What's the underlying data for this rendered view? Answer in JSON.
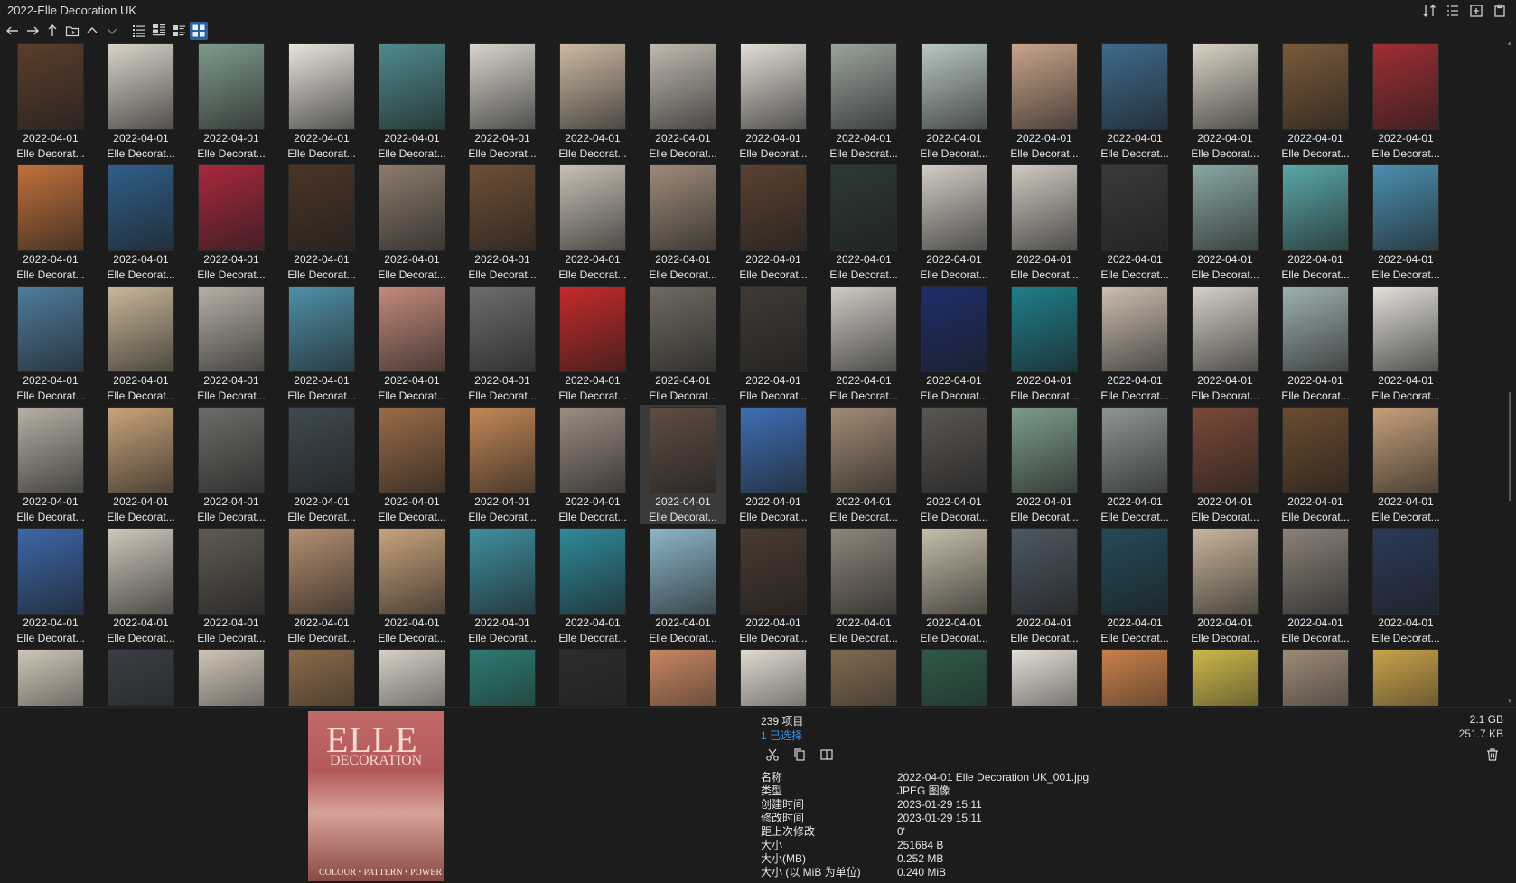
{
  "window": {
    "title": "2022-Elle Decoration UK"
  },
  "toolbar_icons": {
    "top_right": [
      "sort-icon",
      "details-view-icon",
      "new-tab-icon",
      "clipboard-icon"
    ],
    "nav": [
      "back-arrow-icon",
      "forward-arrow-icon",
      "up-arrow-icon",
      "folder-icon",
      "chevron-up-icon",
      "chevron-down-icon",
      "list-view-icon",
      "details-view-icon",
      "tiles-view-icon",
      "thumbnails-view-icon"
    ]
  },
  "grid": {
    "items": [
      {
        "l1": "2022-04-01",
        "l2": "Elle Decorat...",
        "c": "#5a3e2c"
      },
      {
        "l1": "2022-04-01",
        "l2": "Elle Decorat...",
        "c": "#d9d3c8"
      },
      {
        "l1": "2022-04-01",
        "l2": "Elle Decorat...",
        "c": "#7e9a8b"
      },
      {
        "l1": "2022-04-01",
        "l2": "Elle Decorat...",
        "c": "#e8e4dc"
      },
      {
        "l1": "2022-04-01",
        "l2": "Elle Decorat...",
        "c": "#4f8a8c"
      },
      {
        "l1": "2022-04-01",
        "l2": "Elle Decorat...",
        "c": "#d8d4cc"
      },
      {
        "l1": "2022-04-01",
        "l2": "Elle Decorat...",
        "c": "#cbb9a4"
      },
      {
        "l1": "2022-04-01",
        "l2": "Elle Decorat...",
        "c": "#bfb8ae"
      },
      {
        "l1": "2022-04-01",
        "l2": "Elle Decorat...",
        "c": "#e2ddd5"
      },
      {
        "l1": "2022-04-01",
        "l2": "Elle Decorat...",
        "c": "#9aa39c"
      },
      {
        "l1": "2022-04-01",
        "l2": "Elle Decorat...",
        "c": "#b8c7c2"
      },
      {
        "l1": "2022-04-01",
        "l2": "Elle Decorat...",
        "c": "#c9a48a"
      },
      {
        "l1": "2022-04-01",
        "l2": "Elle Decorat...",
        "c": "#3e6a8c"
      },
      {
        "l1": "2022-04-01",
        "l2": "Elle Decorat...",
        "c": "#d9d2c4"
      },
      {
        "l1": "2022-04-01",
        "l2": "Elle Decorat...",
        "c": "#7a5a3a"
      },
      {
        "l1": "2022-04-01",
        "l2": "Elle Decorat...",
        "c": "#9e2e34"
      },
      {
        "l1": "2022-04-01",
        "l2": "Elle Decorat...",
        "c": "#c0713c"
      },
      {
        "l1": "2022-04-01",
        "l2": "Elle Decorat...",
        "c": "#2f5f8a"
      },
      {
        "l1": "2022-04-01",
        "l2": "Elle Decorat...",
        "c": "#a8283c"
      },
      {
        "l1": "2022-04-01",
        "l2": "Elle Decorat...",
        "c": "#4a3526"
      },
      {
        "l1": "2022-04-01",
        "l2": "Elle Decorat...",
        "c": "#8b7b6c"
      },
      {
        "l1": "2022-04-01",
        "l2": "Elle Decorat...",
        "c": "#6e4f37"
      },
      {
        "l1": "2022-04-01",
        "l2": "Elle Decorat...",
        "c": "#c8c0b5"
      },
      {
        "l1": "2022-04-01",
        "l2": "Elle Decorat...",
        "c": "#9c8a78"
      },
      {
        "l1": "2022-04-01",
        "l2": "Elle Decorat...",
        "c": "#5a4130"
      },
      {
        "l1": "2022-04-01",
        "l2": "Elle Decorat...",
        "c": "#2d3a34"
      },
      {
        "l1": "2022-04-01",
        "l2": "Elle Decorat...",
        "c": "#d2cdc5"
      },
      {
        "l1": "2022-04-01",
        "l2": "Elle Decorat...",
        "c": "#cfcac1"
      },
      {
        "l1": "2022-04-01",
        "l2": "Elle Decorat...",
        "c": "#3c3a38"
      },
      {
        "l1": "2022-04-01",
        "l2": "Elle Decorat...",
        "c": "#89a7a3"
      },
      {
        "l1": "2022-04-01",
        "l2": "Elle Decorat...",
        "c": "#5aa7a7"
      },
      {
        "l1": "2022-04-01",
        "l2": "Elle Decorat...",
        "c": "#4a8fb0"
      },
      {
        "l1": "2022-04-01",
        "l2": "Elle Decorat...",
        "c": "#4f7c9e"
      },
      {
        "l1": "2022-04-01",
        "l2": "Elle Decorat...",
        "c": "#c9b89a"
      },
      {
        "l1": "2022-04-01",
        "l2": "Elle Decorat...",
        "c": "#b7b0a6"
      },
      {
        "l1": "2022-04-01",
        "l2": "Elle Decorat...",
        "c": "#4f90a8"
      },
      {
        "l1": "2022-04-01",
        "l2": "Elle Decorat...",
        "c": "#c48a7c"
      },
      {
        "l1": "2022-04-01",
        "l2": "Elle Decorat...",
        "c": "#6b6d6f"
      },
      {
        "l1": "2022-04-01",
        "l2": "Elle Decorat...",
        "c": "#c62a2a"
      },
      {
        "l1": "2022-04-01",
        "l2": "Elle Decorat...",
        "c": "#6f6a60"
      },
      {
        "l1": "2022-04-01",
        "l2": "Elle Decorat...",
        "c": "#3f3a35"
      },
      {
        "l1": "2022-04-01",
        "l2": "Elle Decorat...",
        "c": "#cfcbc4"
      },
      {
        "l1": "2022-04-01",
        "l2": "Elle Decorat...",
        "c": "#1e2e6a"
      },
      {
        "l1": "2022-04-01",
        "l2": "Elle Decorat...",
        "c": "#1f7e8a"
      },
      {
        "l1": "2022-04-01",
        "l2": "Elle Decorat...",
        "c": "#cdbfb0"
      },
      {
        "l1": "2022-04-01",
        "l2": "Elle Decorat...",
        "c": "#d6d1c7"
      },
      {
        "l1": "2022-04-01",
        "l2": "Elle Decorat...",
        "c": "#9fb0b0"
      },
      {
        "l1": "2022-04-01",
        "l2": "Elle Decorat...",
        "c": "#e3e0da"
      },
      {
        "l1": "2022-04-01",
        "l2": "Elle Decorat...",
        "c": "#b6b0a4"
      },
      {
        "l1": "2022-04-01",
        "l2": "Elle Decorat...",
        "c": "#c9a47a"
      },
      {
        "l1": "2022-04-01",
        "l2": "Elle Decorat...",
        "c": "#6d6c68"
      },
      {
        "l1": "2022-04-01",
        "l2": "Elle Decorat...",
        "c": "#3e4a52"
      },
      {
        "l1": "2022-04-01",
        "l2": "Elle Decorat...",
        "c": "#9a6c48"
      },
      {
        "l1": "2022-04-01",
        "l2": "Elle Decorat...",
        "c": "#c48856"
      },
      {
        "l1": "2022-04-01",
        "l2": "Elle Decorat...",
        "c": "#9b8d82"
      },
      {
        "l1": "2022-04-01",
        "l2": "Elle Decorat...",
        "c": "#5e4d42"
      },
      {
        "l1": "2022-04-01",
        "l2": "Elle Decorat...",
        "c": "#3e6fb5"
      },
      {
        "l1": "2022-04-01",
        "l2": "Elle Decorat...",
        "c": "#a18b76"
      },
      {
        "l1": "2022-04-01",
        "l2": "Elle Decorat...",
        "c": "#5a5652"
      },
      {
        "l1": "2022-04-01",
        "l2": "Elle Decorat...",
        "c": "#7d9c8a"
      },
      {
        "l1": "2022-04-01",
        "l2": "Elle Decorat...",
        "c": "#8e9694"
      },
      {
        "l1": "2022-04-01",
        "l2": "Elle Decorat...",
        "c": "#7a4a38"
      },
      {
        "l1": "2022-04-01",
        "l2": "Elle Decorat...",
        "c": "#6b4c30"
      },
      {
        "l1": "2022-04-01",
        "l2": "Elle Decorat...",
        "c": "#c6a07a"
      },
      {
        "l1": "2022-04-01",
        "l2": "Elle Decorat...",
        "c": "#3c67a8"
      },
      {
        "l1": "2022-04-01",
        "l2": "Elle Decorat...",
        "c": "#cfc7bb"
      },
      {
        "l1": "2022-04-01",
        "l2": "Elle Decorat...",
        "c": "#5f5a52"
      },
      {
        "l1": "2022-04-01",
        "l2": "Elle Decorat...",
        "c": "#b58f70"
      },
      {
        "l1": "2022-04-01",
        "l2": "Elle Decorat...",
        "c": "#c9a37c"
      },
      {
        "l1": "2022-04-01",
        "l2": "Elle Decorat...",
        "c": "#3f8fa0"
      },
      {
        "l1": "2022-04-01",
        "l2": "Elle Decorat...",
        "c": "#2f8a9a"
      },
      {
        "l1": "2022-04-01",
        "l2": "Elle Decorat...",
        "c": "#8cb6c9"
      },
      {
        "l1": "2022-04-01",
        "l2": "Elle Decorat...",
        "c": "#4a3a30"
      },
      {
        "l1": "2022-04-01",
        "l2": "Elle Decorat...",
        "c": "#8f857a"
      },
      {
        "l1": "2022-04-01",
        "l2": "Elle Decorat...",
        "c": "#c7bda9"
      },
      {
        "l1": "2022-04-01",
        "l2": "Elle Decorat...",
        "c": "#4c5862"
      },
      {
        "l1": "2022-04-01",
        "l2": "Elle Decorat...",
        "c": "#244a58"
      },
      {
        "l1": "2022-04-01",
        "l2": "Elle Decorat...",
        "c": "#c9b59c"
      },
      {
        "l1": "2022-04-01",
        "l2": "Elle Decorat...",
        "c": "#8b8178"
      },
      {
        "l1": "2022-04-01",
        "l2": "Elle Decorat...",
        "c": "#2b3a5a"
      },
      {
        "l1": "",
        "l2": "",
        "c": "#cfc6b7"
      },
      {
        "l1": "",
        "l2": "",
        "c": "#3a3e44"
      },
      {
        "l1": "",
        "l2": "",
        "c": "#cfc4b6"
      },
      {
        "l1": "",
        "l2": "",
        "c": "#8a6a4a"
      },
      {
        "l1": "",
        "l2": "",
        "c": "#d6d0c6"
      },
      {
        "l1": "",
        "l2": "",
        "c": "#2e7a72"
      },
      {
        "l1": "",
        "l2": "",
        "c": "#2a2c2e"
      },
      {
        "l1": "",
        "l2": "",
        "c": "#c78660"
      },
      {
        "l1": "",
        "l2": "",
        "c": "#e0dad0"
      },
      {
        "l1": "",
        "l2": "",
        "c": "#7f6a52"
      },
      {
        "l1": "",
        "l2": "",
        "c": "#2f5a48"
      },
      {
        "l1": "",
        "l2": "",
        "c": "#e2ddd5"
      },
      {
        "l1": "",
        "l2": "",
        "c": "#c8804a"
      },
      {
        "l1": "",
        "l2": "",
        "c": "#cbb84a"
      },
      {
        "l1": "",
        "l2": "",
        "c": "#9c8a78"
      },
      {
        "l1": "",
        "l2": "",
        "c": "#c9a24a"
      }
    ],
    "selected_index": 55
  },
  "preview": {
    "logo": "ELLE",
    "sub": "DECORATION",
    "foot": "COLOUR • PATTERN • POWER"
  },
  "status": {
    "item_count": "239 项目",
    "selected_count": "1 已选择",
    "total_size": "2.1 GB",
    "selected_size": "251.7 KB"
  },
  "actions": [
    "cut-icon",
    "copy-icon",
    "copy-path-icon",
    "delete-icon"
  ],
  "properties": [
    {
      "key": "名称",
      "value": "2022-04-01 Elle Decoration UK_001.jpg"
    },
    {
      "key": "类型",
      "value": "JPEG 图像"
    },
    {
      "key": "创建时间",
      "value": "2023-01-29  15:11"
    },
    {
      "key": "修改时间",
      "value": "2023-01-29  15:11"
    },
    {
      "key": "距上次修改",
      "value": "0'"
    },
    {
      "key": "大小",
      "value": "251684 B"
    },
    {
      "key": "大小(MB)",
      "value": "0.252 MB"
    },
    {
      "key": "大小 (以 MiB 为单位)",
      "value": "0.240 MiB"
    }
  ]
}
